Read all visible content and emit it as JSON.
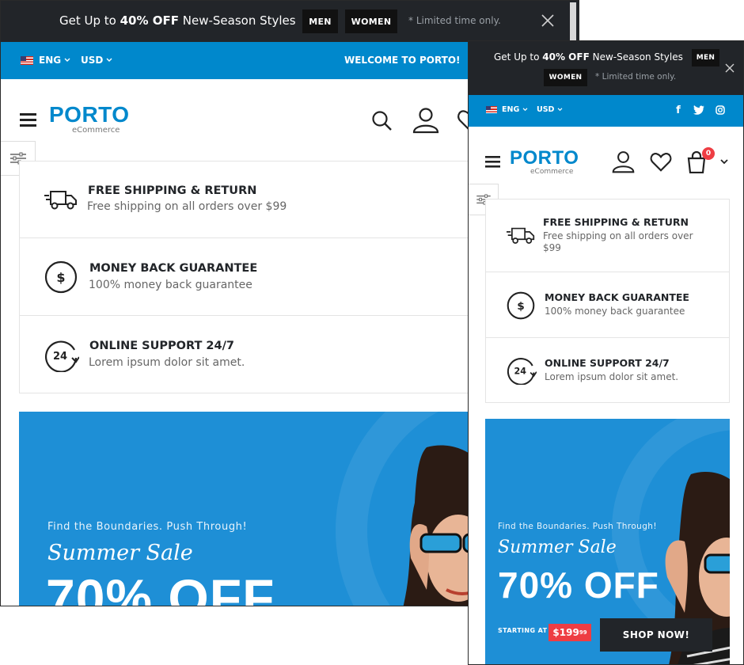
{
  "promo": {
    "text_prefix": "Get Up to ",
    "text_bold": "40% OFF",
    "text_suffix": " New-Season Styles",
    "men_label": "MEN",
    "women_label": "WOMEN",
    "note": "* Limited time only."
  },
  "topbar": {
    "language": "ENG",
    "currency": "USD",
    "welcome": "WELCOME TO PORTO!",
    "social_facebook": "f"
  },
  "header": {
    "logo_main": "PORTO",
    "logo_sub": "eCommerce",
    "cart_count": "0"
  },
  "features": [
    {
      "title": "FREE SHIPPING & RETURN",
      "desc": "Free shipping on all orders over $99",
      "icon": "truck-icon"
    },
    {
      "title": "MONEY BACK GUARANTEE",
      "desc": "100% money back guarantee",
      "icon": "dollar-circle-icon",
      "glyph": "$"
    },
    {
      "title": "ONLINE SUPPORT 24/7",
      "desc": "Lorem ipsum dolor sit amet.",
      "icon": "support-24-icon",
      "glyph": "24"
    }
  ],
  "banner": {
    "kicker": "Find the Boundaries. Push Through!",
    "script": "Summer Sale",
    "headline": "70% OFF",
    "starting_at": "STARTING AT",
    "price_main": "$199",
    "price_cents": "99",
    "cta": "SHOP NOW!"
  },
  "colors": {
    "brand_blue": "#0088cc",
    "dark": "#222529",
    "banner_blue": "#1e8fd6",
    "price_red": "#ee3d43"
  }
}
